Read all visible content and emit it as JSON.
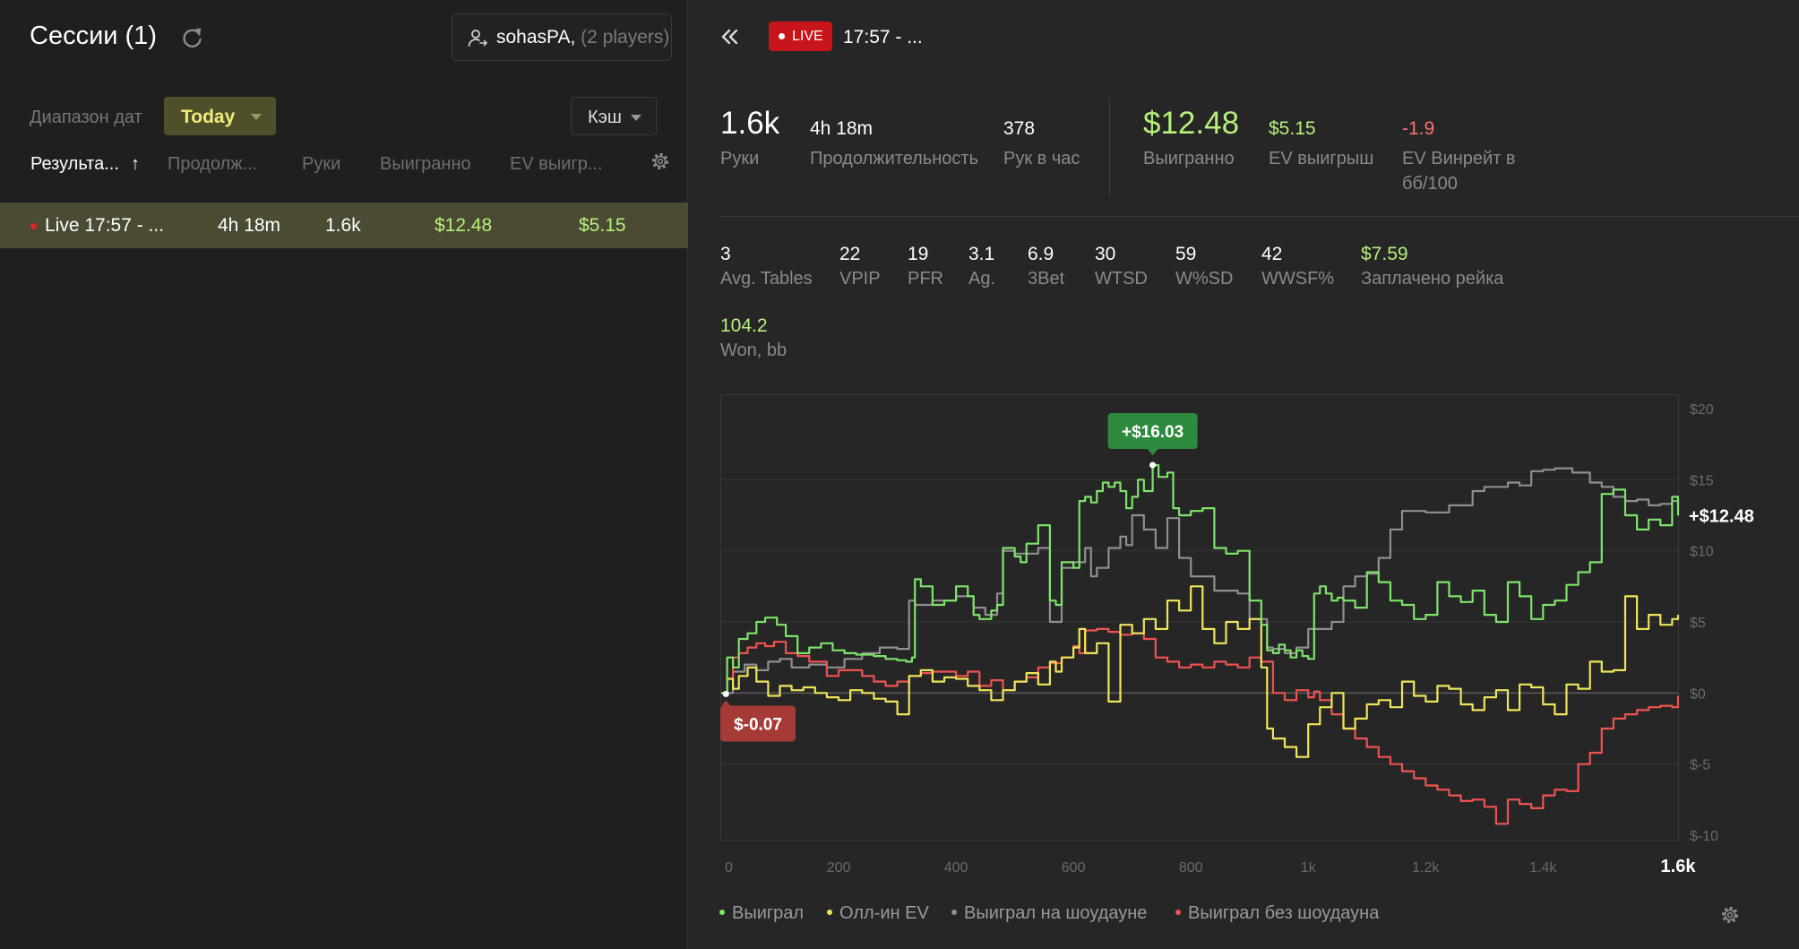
{
  "left_panel": {
    "title": "Сессии (1)",
    "player": {
      "name": "sohasPA",
      "count": "(2 players)"
    },
    "date_label": "Диапазон дат",
    "date_value": "Today",
    "game_type": "Кэш",
    "columns": [
      "Результа...",
      "Продолж...",
      "Руки",
      "Выигранно",
      "EV выигр..."
    ],
    "sessions": [
      {
        "name": "Live 17:57 - ...",
        "duration": "4h 18m",
        "hands": "1.6k",
        "won": "$12.48",
        "ev": "$5.15"
      }
    ]
  },
  "header": {
    "live_badge": "LIVE",
    "session": "17:57 - ..."
  },
  "summary": {
    "hands": {
      "value": "1.6k",
      "label": "Руки"
    },
    "duration": {
      "value": "4h 18m",
      "label": "Продолжительность"
    },
    "hands_per_hour": {
      "value": "378",
      "label": "Рук в час"
    },
    "won": {
      "value": "$12.48",
      "label": "Выигранно"
    },
    "ev_won": {
      "value": "$5.15",
      "label": "EV выигрыш"
    },
    "ev_winrate": {
      "value": "-1.9",
      "label1": "EV Винрейт в",
      "label2": "бб/100"
    }
  },
  "stats": [
    {
      "value": "3",
      "label": "Avg. Tables"
    },
    {
      "value": "22",
      "label": "VPIP"
    },
    {
      "value": "19",
      "label": "PFR"
    },
    {
      "value": "3.1",
      "label": "Ag."
    },
    {
      "value": "6.9",
      "label": "3Bet"
    },
    {
      "value": "30",
      "label": "WTSD"
    },
    {
      "value": "59",
      "label": "W%SD"
    },
    {
      "value": "42",
      "label": "WWSF%"
    },
    {
      "value": "$7.59",
      "label": "Заплачено рейка"
    }
  ],
  "won_bb": {
    "value": "104.2",
    "label": "Won, bb"
  },
  "colors": {
    "green": "#7ee36a",
    "yellow": "#f0e55a",
    "gray": "#8f8f8f",
    "red": "#ef5350",
    "accent_green": "#b6f07a",
    "live_red": "#c8151b"
  },
  "chart_data": {
    "type": "line",
    "x_ticks": [
      "0",
      "200",
      "400",
      "600",
      "800",
      "1k",
      "1.2k",
      "1.4k",
      "1.6k"
    ],
    "y_ticks": [
      "$20",
      "$15",
      "$10",
      "$5",
      "$0",
      "$-5",
      "$-10"
    ],
    "xlim": [
      0,
      1630
    ],
    "ylim": [
      -10,
      20
    ],
    "grid": true,
    "legend_position": "bottom-left",
    "max_label": "+$16.03",
    "min_label": "$-0.07",
    "end_label": "+$12.48",
    "series": [
      {
        "name": "Выиграл",
        "color": "#7ee36a",
        "x": [
          0,
          10,
          20,
          30,
          45,
          60,
          75,
          95,
          110,
          130,
          150,
          170,
          190,
          210,
          230,
          260,
          280,
          300,
          315,
          325,
          330,
          340,
          360,
          380,
          400,
          420,
          430,
          440,
          460,
          470,
          480,
          500,
          510,
          520,
          540,
          560,
          570,
          580,
          600,
          610,
          620,
          630,
          640,
          650,
          660,
          670,
          680,
          690,
          700,
          710,
          720,
          735,
          745,
          760,
          770,
          780,
          800,
          820,
          840,
          860,
          880,
          900,
          920,
          930,
          940,
          950,
          960,
          970,
          980,
          990,
          1000,
          1010,
          1020,
          1030,
          1040,
          1050,
          1060,
          1080,
          1100,
          1120,
          1140,
          1160,
          1180,
          1200,
          1220,
          1240,
          1260,
          1280,
          1300,
          1320,
          1340,
          1360,
          1380,
          1400,
          1420,
          1440,
          1460,
          1480,
          1500,
          1520,
          1540,
          1560,
          1580,
          1600,
          1620,
          1630
        ],
        "y": [
          0,
          2.5,
          1.8,
          3.8,
          4.2,
          5,
          5.3,
          4.8,
          4,
          2.8,
          3.2,
          3.5,
          3,
          2.8,
          2.7,
          2.6,
          2.4,
          2.3,
          2.2,
          2.5,
          8,
          7.5,
          6.2,
          6.5,
          7.5,
          6.8,
          5.5,
          5.2,
          5.8,
          6.2,
          10.2,
          9.6,
          9.2,
          10.5,
          11.8,
          6.5,
          6.2,
          9.2,
          8.8,
          13.5,
          13.8,
          13.4,
          14.2,
          14.8,
          14.5,
          14.8,
          14.2,
          13,
          13.8,
          15,
          14.2,
          16.03,
          15.2,
          15.5,
          13,
          12.5,
          12.8,
          13,
          10.2,
          9.8,
          10,
          6.5,
          4.8,
          3,
          2.8,
          3.4,
          3,
          2.5,
          3,
          2.6,
          2.4,
          7,
          7.5,
          7,
          6.5,
          6.7,
          6.5,
          6,
          8.5,
          7.8,
          6.5,
          6.2,
          5.2,
          5.5,
          7.8,
          6.8,
          6.4,
          7.2,
          5.5,
          5,
          7.8,
          6.8,
          5.2,
          6.2,
          6.5,
          7.6,
          8.5,
          9.2,
          14,
          14.3,
          12.5,
          11.5,
          12.2,
          11.8,
          13.8,
          12.48
        ]
      },
      {
        "name": "Олл-ин EV",
        "color": "#f0e55a",
        "x": [
          0,
          10,
          20,
          30,
          45,
          60,
          80,
          100,
          120,
          140,
          160,
          180,
          200,
          220,
          240,
          260,
          280,
          300,
          320,
          340,
          360,
          380,
          400,
          420,
          440,
          460,
          480,
          500,
          520,
          540,
          560,
          570,
          580,
          600,
          610,
          620,
          640,
          660,
          680,
          700,
          720,
          740,
          760,
          780,
          800,
          820,
          840,
          860,
          880,
          900,
          920,
          930,
          940,
          960,
          980,
          1000,
          1020,
          1040,
          1060,
          1080,
          1100,
          1120,
          1140,
          1160,
          1180,
          1200,
          1220,
          1240,
          1260,
          1280,
          1300,
          1320,
          1340,
          1360,
          1380,
          1400,
          1420,
          1440,
          1460,
          1480,
          1500,
          1520,
          1540,
          1560,
          1580,
          1600,
          1620,
          1630
        ],
        "y": [
          0,
          1,
          0.3,
          1.2,
          1.8,
          0.8,
          -0.2,
          0.5,
          0.2,
          0.4,
          0,
          -0.3,
          -0.5,
          0.2,
          0,
          -0.4,
          -0.6,
          -1.5,
          1.2,
          1.6,
          0.8,
          1.1,
          1,
          0.5,
          0.2,
          -0.5,
          0.2,
          0.8,
          1.4,
          0.6,
          2.2,
          1.5,
          2.5,
          3.2,
          4.5,
          2.8,
          3.5,
          -0.6,
          4.8,
          4.2,
          5.2,
          4.5,
          6.5,
          5.8,
          7.5,
          4.5,
          3.5,
          5,
          4.5,
          5.2,
          1.8,
          -2.5,
          -3.2,
          -3.8,
          -4.5,
          -2.2,
          -1,
          0,
          -2.5,
          -1.8,
          -0.8,
          -0.5,
          -1,
          0.8,
          -0.2,
          -0.6,
          0.5,
          0.3,
          -0.8,
          -1.2,
          -0.3,
          0.2,
          -1.2,
          0.6,
          0.4,
          -0.8,
          -1.5,
          0.6,
          0.3,
          2.2,
          1.5,
          1.6,
          6.8,
          4.5,
          5.5,
          4.8,
          5.2,
          5.5
        ]
      },
      {
        "name": "Выиграл на шоудауне",
        "color": "#8f8f8f",
        "x": [
          0,
          20,
          40,
          60,
          80,
          100,
          120,
          150,
          180,
          210,
          240,
          270,
          300,
          320,
          330,
          360,
          400,
          430,
          450,
          470,
          480,
          500,
          540,
          560,
          580,
          600,
          620,
          630,
          640,
          660,
          680,
          690,
          700,
          720,
          740,
          760,
          780,
          800,
          840,
          880,
          900,
          930,
          940,
          960,
          980,
          1000,
          1040,
          1060,
          1080,
          1100,
          1120,
          1140,
          1160,
          1200,
          1240,
          1280,
          1300,
          1340,
          1360,
          1380,
          1400,
          1420,
          1450,
          1480,
          1500,
          1520,
          1540,
          1560,
          1580,
          1600,
          1620,
          1630
        ],
        "y": [
          0,
          1.5,
          2,
          1.6,
          2.2,
          2.4,
          1.8,
          2,
          1.8,
          2.4,
          2.8,
          3.2,
          3.1,
          6.5,
          6.2,
          6.5,
          6.8,
          6,
          5.5,
          7,
          10,
          9.8,
          10.2,
          5,
          8.8,
          9.2,
          10.2,
          8.2,
          8.8,
          10.2,
          11,
          10.4,
          12.5,
          11.5,
          10.2,
          12.3,
          9.5,
          8.2,
          7.2,
          7,
          5.2,
          3.2,
          3.1,
          2.8,
          3.2,
          4.5,
          5,
          7.5,
          8.2,
          8.4,
          9.5,
          11.5,
          12.8,
          12.7,
          13.2,
          14.2,
          14.5,
          14.8,
          14.6,
          15.6,
          15.7,
          15.8,
          15.5,
          14.8,
          14.5,
          13.8,
          13.5,
          13.6,
          13.2,
          13.3,
          13.5,
          13.2
        ]
      },
      {
        "name": "Выиграл без шоудауна",
        "color": "#ef5350",
        "x": [
          0,
          10,
          20,
          30,
          45,
          60,
          75,
          90,
          110,
          130,
          150,
          180,
          200,
          240,
          260,
          280,
          300,
          320,
          340,
          360,
          380,
          400,
          420,
          440,
          460,
          480,
          500,
          520,
          540,
          560,
          580,
          600,
          610,
          620,
          640,
          660,
          680,
          700,
          720,
          740,
          760,
          780,
          800,
          820,
          840,
          860,
          880,
          900,
          920,
          940,
          960,
          980,
          1000,
          1010,
          1020,
          1040,
          1060,
          1080,
          1100,
          1120,
          1140,
          1160,
          1180,
          1200,
          1220,
          1240,
          1260,
          1280,
          1300,
          1320,
          1340,
          1360,
          1380,
          1400,
          1420,
          1440,
          1460,
          1480,
          1500,
          1520,
          1540,
          1560,
          1580,
          1600,
          1620,
          1630
        ],
        "y": [
          0,
          1,
          2.5,
          2.8,
          3.2,
          3.5,
          3.3,
          3.6,
          2.8,
          2.6,
          2.2,
          1.2,
          1.6,
          1.2,
          0.8,
          0.5,
          0.8,
          1.2,
          1.4,
          1.5,
          1.5,
          1.2,
          1.5,
          0.5,
          0.9,
          0.2,
          0.8,
          1.1,
          1.8,
          2.1,
          2.5,
          3.3,
          2.8,
          4.4,
          4.5,
          4.3,
          4.1,
          4.2,
          3.8,
          2.5,
          2.2,
          1.8,
          2,
          1.8,
          2.2,
          2,
          1.8,
          2.5,
          2.2,
          0,
          -0.5,
          0.2,
          -0.3,
          0.1,
          -0.5,
          -1.5,
          -2.5,
          -3.2,
          -3.8,
          -4.5,
          -5,
          -5.5,
          -6,
          -6.5,
          -6.8,
          -7.2,
          -7.6,
          -7.5,
          -8,
          -9.2,
          -7.5,
          -7.8,
          -8.1,
          -7.2,
          -6.8,
          -6.9,
          -5,
          -4.2,
          -2.5,
          -1.8,
          -1.5,
          -1.2,
          -1,
          -0.9,
          -1,
          -0.2
        ]
      }
    ]
  }
}
